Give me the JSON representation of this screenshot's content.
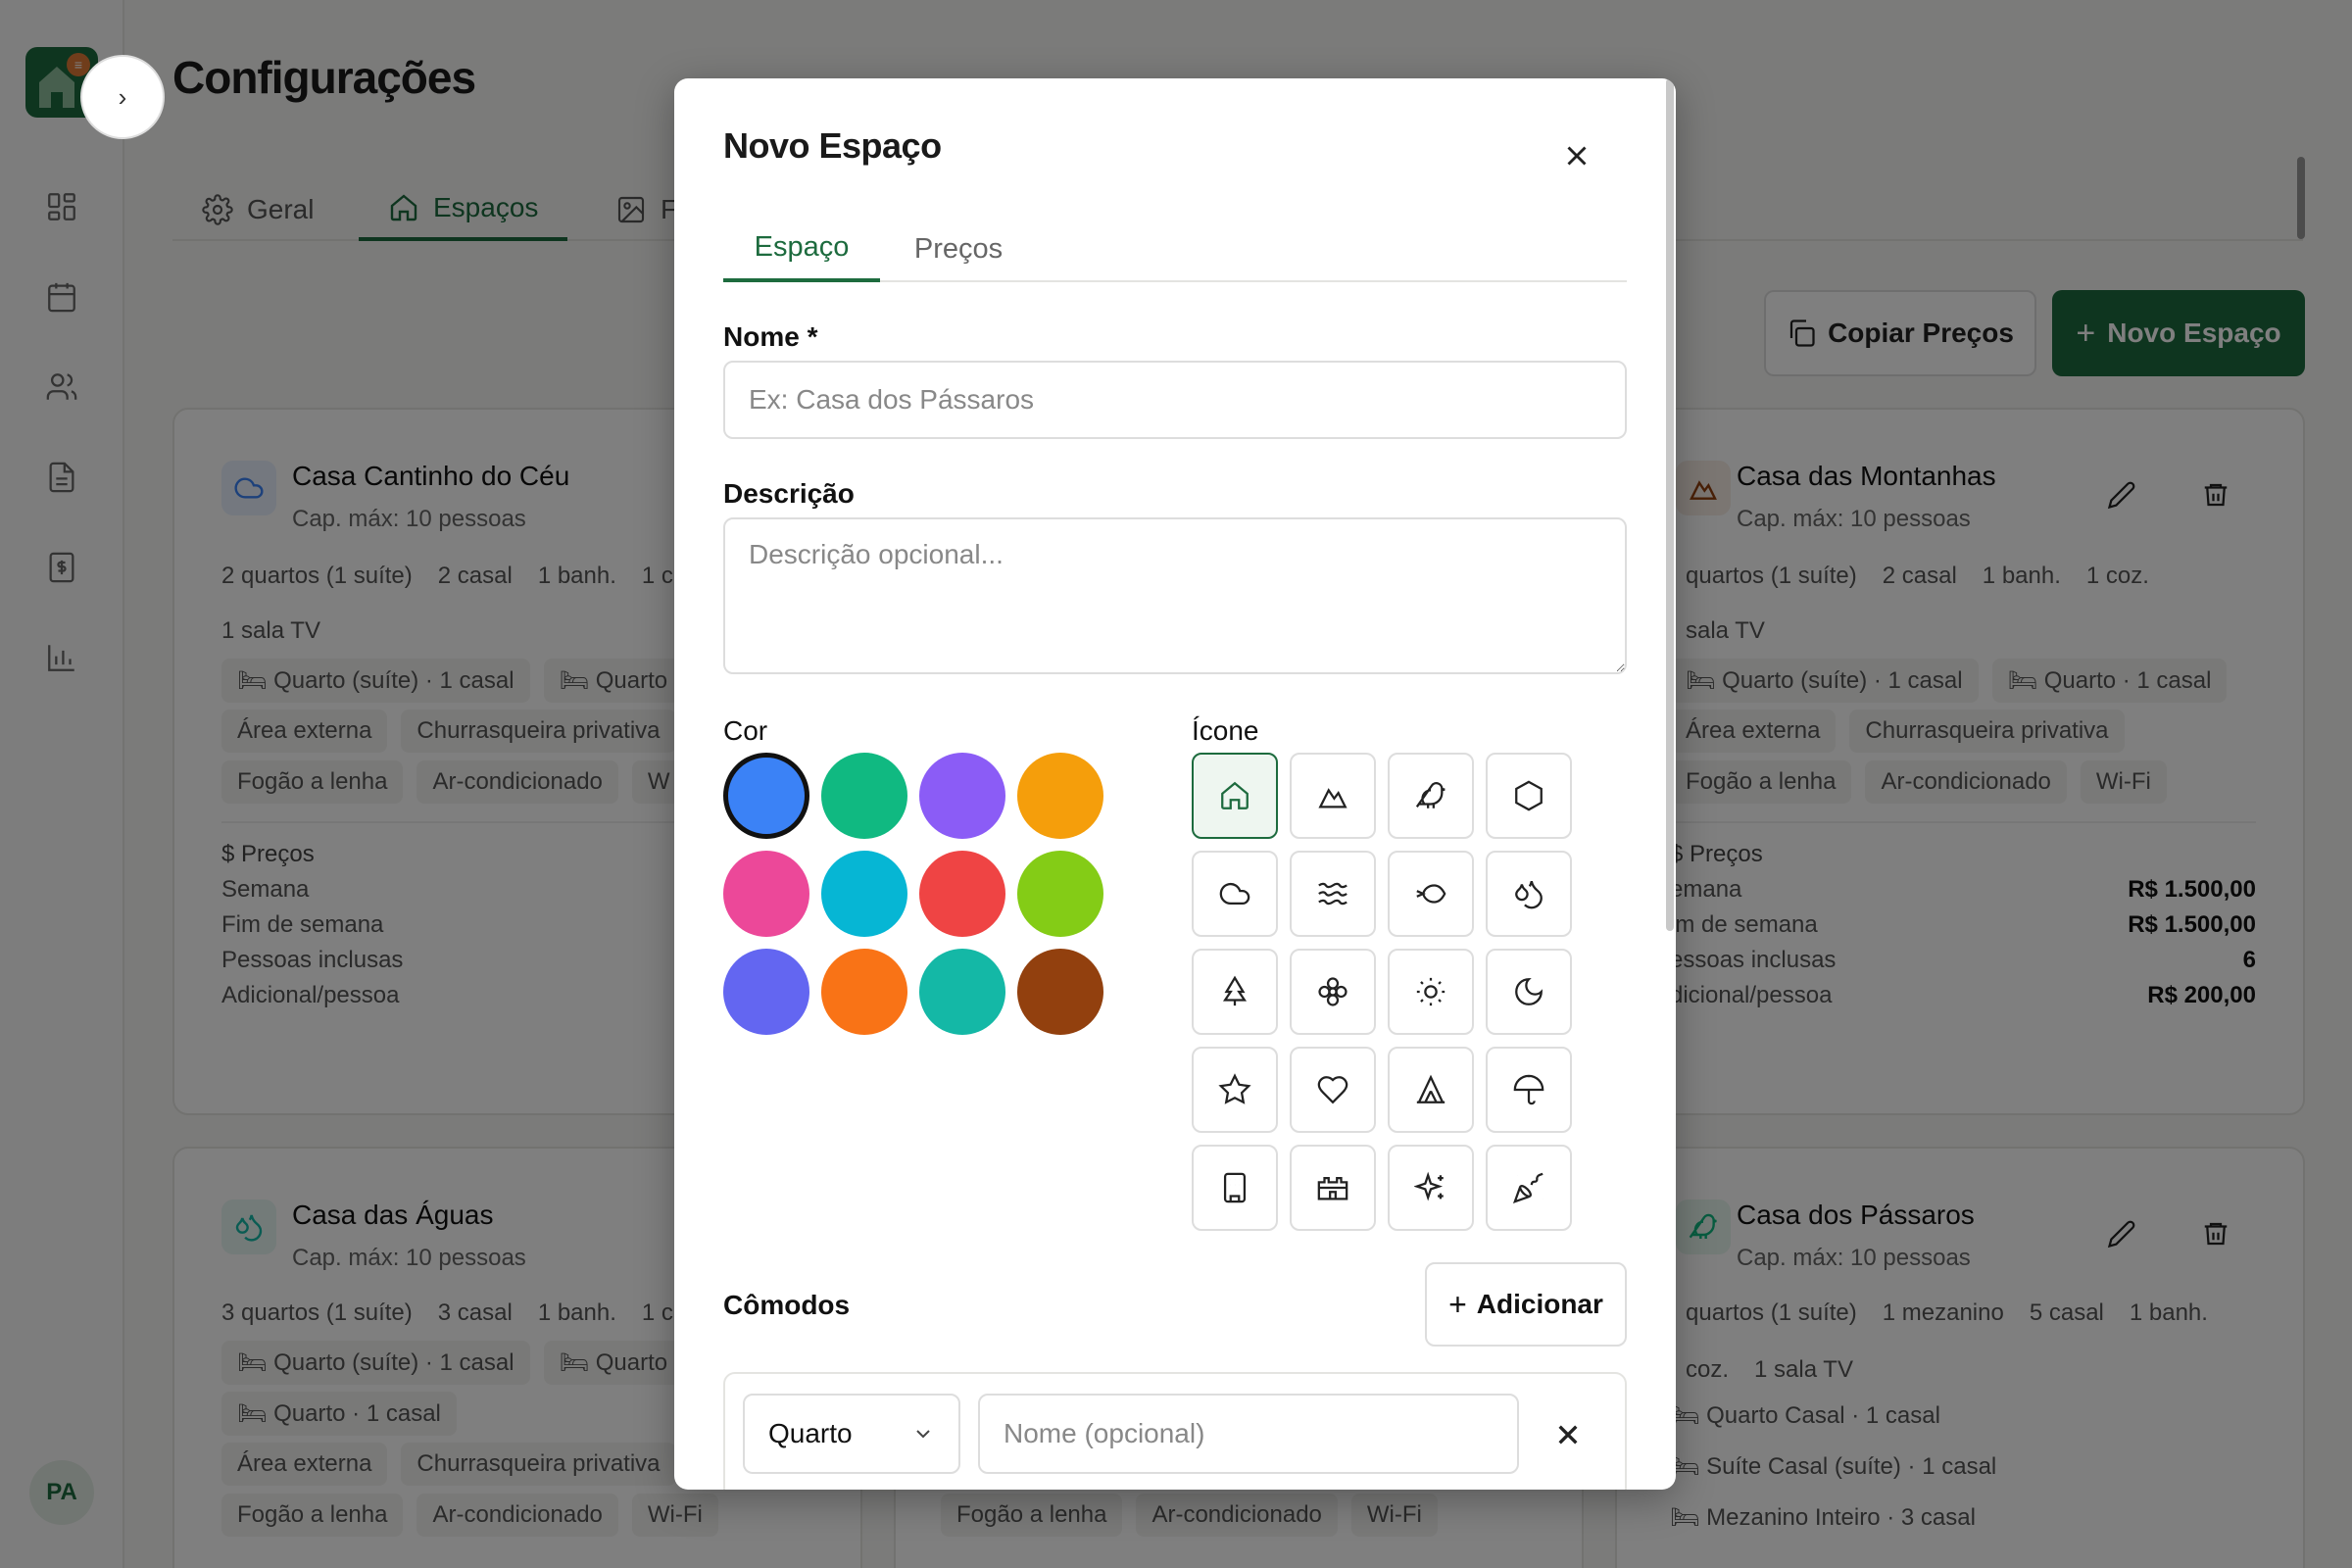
{
  "sidebar": {
    "logo_badge": "≡",
    "toggle": "›",
    "items": [
      "dashboard-icon",
      "calendar-icon",
      "users-icon",
      "document-icon",
      "billing-icon",
      "reports-icon"
    ],
    "avatar": "PA"
  },
  "page": {
    "title": "Configurações",
    "tabs": [
      {
        "label": "Geral",
        "icon": "gear-icon"
      },
      {
        "label": "Espaços",
        "icon": "home-icon"
      },
      {
        "label": "F",
        "icon": "image-icon"
      }
    ]
  },
  "actions": {
    "copy_label": "Copiar Preços",
    "new_label": "Novo Espaço",
    "new_icon": "+"
  },
  "cards": [
    {
      "title": "Casa Cantinho do Céu",
      "cap": "Cap. máx: 10 pessoas",
      "rooms_line": [
        "2 quartos (1 suíte)",
        "2 casal",
        "1 banh.",
        "1 c"
      ],
      "rooms_line2": [
        "1 sala TV"
      ],
      "room_chips": [
        "Quarto (suíte) · 1 casal",
        "Quarto"
      ],
      "chips1": [
        "Área externa",
        "Churrasqueira privativa"
      ],
      "chips2": [
        "Fogão a lenha",
        "Ar-condicionado",
        "W"
      ],
      "prices_title": "Preços",
      "price_labels": [
        "Semana",
        "Fim de semana",
        "Pessoas inclusas",
        "Adicional/pessoa"
      ],
      "price_values": [
        "",
        "",
        "",
        ""
      ],
      "icon": "cloud-icon",
      "color": "#3b82f6"
    },
    {
      "title": "Casa das Montanhas",
      "cap": "Cap. máx: 10 pessoas",
      "rooms_line": [
        "quartos (1 suíte)",
        "2 casal",
        "1 banh.",
        "1 coz."
      ],
      "rooms_line2": [
        "sala TV"
      ],
      "room_chips": [
        "Quarto (suíte) · 1 casal",
        "Quarto · 1 casal"
      ],
      "chips1": [
        "Área externa",
        "Churrasqueira privativa"
      ],
      "chips2": [
        "Fogão a lenha",
        "Ar-condicionado",
        "Wi-Fi"
      ],
      "prices_title": "Preços",
      "price_labels": [
        "emana",
        "im de semana",
        "essoas inclusas",
        "dicional/pessoa"
      ],
      "price_values": [
        "R$ 1.500,00",
        "R$ 1.500,00",
        "6",
        "R$ 200,00"
      ],
      "icon": "mountain-icon",
      "color": "#92400e"
    },
    {
      "title": "Casa das Águas",
      "cap": "Cap. máx: 10 pessoas",
      "rooms_line": [
        "3 quartos (1 suíte)",
        "3 casal",
        "1 banh.",
        "1 c"
      ],
      "room_chips": [
        "Quarto (suíte) · 1 casal",
        "Quarto"
      ],
      "room_chips2": [
        "Quarto · 1 casal"
      ],
      "chips1": [
        "Área externa",
        "Churrasqueira privativa"
      ],
      "chips2": [
        "Fogão a lenha",
        "Ar-condicionado",
        "Wi-Fi"
      ],
      "icon": "droplets-icon",
      "color": "#14b8a6"
    },
    {
      "chips2": [
        "Fogão a lenha",
        "Ar-condicionado",
        "Wi-Fi"
      ]
    },
    {
      "title": "Casa dos Pássaros",
      "cap": "Cap. máx: 10 pessoas",
      "rooms_line": [
        "quartos (1 suíte)",
        "1 mezanino",
        "5 casal",
        "1 banh."
      ],
      "rooms_line2": [
        "coz.",
        "1 sala TV"
      ],
      "room_chips": [
        "Quarto Casal · 1 casal"
      ],
      "room_chips2": [
        "Suíte Casal (suíte) · 1 casal"
      ],
      "room_chips3": [
        "Mezanino Inteiro · 3 casal"
      ],
      "icon": "bird-icon",
      "color": "#10b981"
    }
  ],
  "modal": {
    "title": "Novo Espaço",
    "tabs": [
      "Espaço",
      "Preços"
    ],
    "name_label": "Nome *",
    "name_placeholder": "Ex: Casa dos Pássaros",
    "desc_label": "Descrição",
    "desc_placeholder": "Descrição opcional...",
    "color_label": "Cor",
    "colors": [
      "#3b82f6",
      "#10b981",
      "#8b5cf6",
      "#f59e0b",
      "#ec4899",
      "#06b6d4",
      "#ef4444",
      "#84cc16",
      "#6366f1",
      "#f97316",
      "#14b8a6",
      "#92400e"
    ],
    "selected_color": "#3b82f6",
    "icon_label": "Ícone",
    "icons": [
      "home-icon",
      "mountain-icon",
      "bird-icon",
      "hexagon-icon",
      "cloud-icon",
      "waves-icon",
      "fish-icon",
      "droplets-icon",
      "tree-icon",
      "flower-icon",
      "sun-icon",
      "moon-icon",
      "star-icon",
      "heart-icon",
      "tent-icon",
      "umbrella-icon",
      "building-icon",
      "castle-icon",
      "sparkles-icon",
      "party-icon"
    ],
    "selected_icon": "home-icon",
    "rooms_label": "Cômodos",
    "add_label": "Adicionar",
    "add_icon": "+",
    "room_type": "Quarto",
    "room_name_placeholder": "Nome (opcional)"
  }
}
